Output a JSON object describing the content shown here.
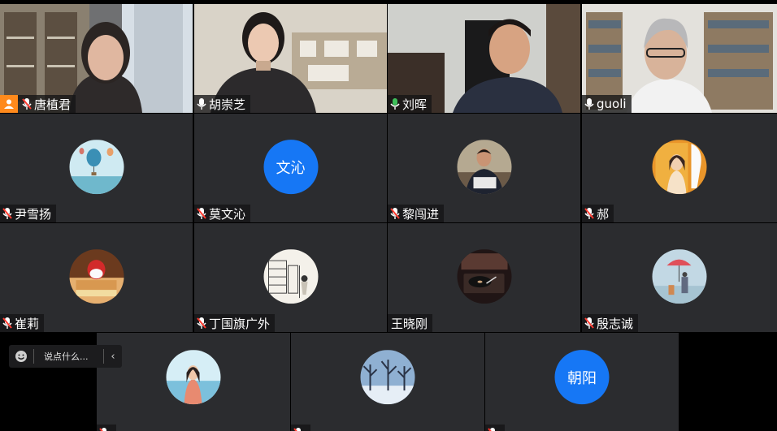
{
  "participants": [
    {
      "id": "p1",
      "name": "唐植君",
      "host": true,
      "mic": "muted",
      "kind": "video"
    },
    {
      "id": "p2",
      "name": "胡崇芝",
      "mic": "on",
      "kind": "video"
    },
    {
      "id": "p3",
      "name": "刘晖",
      "mic": "active",
      "kind": "video",
      "speaking": true
    },
    {
      "id": "p4",
      "name": "guoli",
      "mic": "on",
      "kind": "video"
    },
    {
      "id": "p5",
      "name": "尹雪扬",
      "mic": "muted",
      "kind": "avatar",
      "avatar": "hot-air-balloon"
    },
    {
      "id": "p6",
      "name": "莫文沁",
      "mic": "muted",
      "kind": "text-avatar",
      "avatar_text": "文沁"
    },
    {
      "id": "p7",
      "name": "黎闯进",
      "mic": "muted",
      "kind": "avatar",
      "avatar": "man-at-laptop"
    },
    {
      "id": "p8",
      "name": "郝",
      "mic": "muted",
      "kind": "avatar",
      "avatar": "girl-portrait"
    },
    {
      "id": "p9",
      "name": "崔莉",
      "mic": "muted",
      "kind": "avatar",
      "avatar": "strawberry-cake"
    },
    {
      "id": "p10",
      "name": "丁国旗广外",
      "mic": "muted",
      "kind": "avatar",
      "avatar": "sketch-library"
    },
    {
      "id": "p11",
      "name": "王晓刚",
      "mic": "none",
      "kind": "avatar",
      "avatar": "turntable"
    },
    {
      "id": "p12",
      "name": "殷志诚",
      "mic": "muted",
      "kind": "avatar",
      "avatar": "umbrella-painting"
    },
    {
      "id": "p13",
      "name": "",
      "mic": "muted",
      "kind": "avatar",
      "avatar": "girl-seaside"
    },
    {
      "id": "p14",
      "name": "",
      "mic": "muted",
      "kind": "avatar",
      "avatar": "snowy-trees"
    },
    {
      "id": "p15",
      "name": "",
      "mic": "muted",
      "kind": "text-avatar",
      "avatar_text": "朝阳"
    }
  ],
  "chat": {
    "placeholder": "说点什么...",
    "emoji_icon": "smiley-icon",
    "collapse_icon": "chevron-left-icon"
  },
  "colors": {
    "tile_bg": "#2b2c2f",
    "active_border": "#3fbf5a",
    "text_avatar": "#1677f5",
    "host_badge": "#ff8a1c",
    "mic_muted": "#ff3b30",
    "mic_active": "#3fbf5a"
  }
}
